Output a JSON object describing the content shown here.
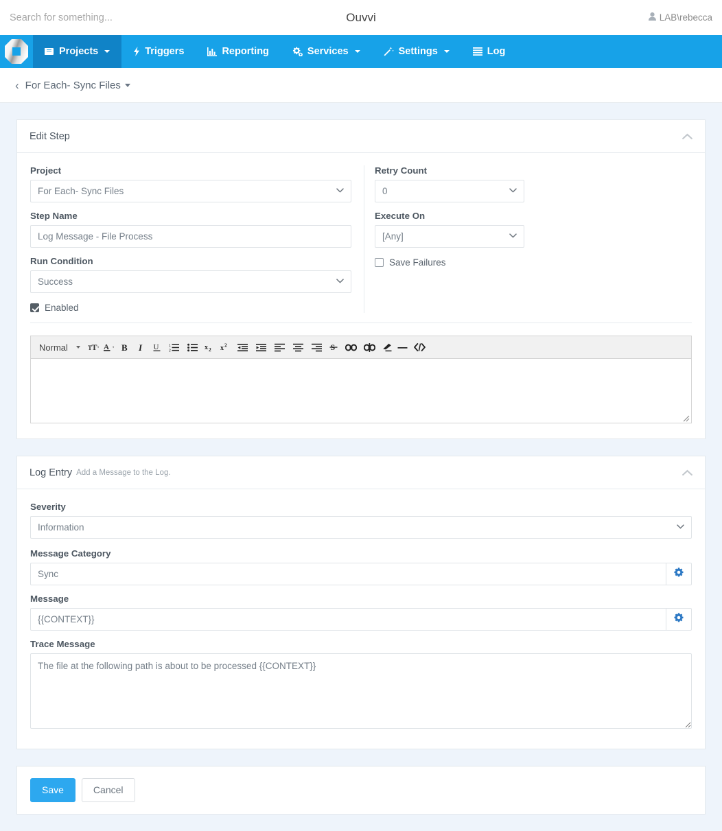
{
  "topbar": {
    "search_placeholder": "Search for something...",
    "search_value": "",
    "brand": "Ouvvi",
    "user": "LAB\\rebecca",
    "user_icon": "user-icon"
  },
  "nav": {
    "logo_icon": "ouvvi-logo-icon",
    "items": [
      {
        "label": "Projects",
        "icon": "book-icon",
        "caret": true,
        "active": true
      },
      {
        "label": "Triggers",
        "icon": "bolt-icon",
        "caret": false,
        "active": false
      },
      {
        "label": "Reporting",
        "icon": "bar-chart-icon",
        "caret": false,
        "active": false
      },
      {
        "label": "Services",
        "icon": "cogs-icon",
        "caret": true,
        "active": false
      },
      {
        "label": "Settings",
        "icon": "magic-wand-icon",
        "caret": true,
        "active": false
      },
      {
        "label": "Log",
        "icon": "align-justify-icon",
        "caret": false,
        "active": false
      }
    ]
  },
  "breadcrumb": {
    "back_icon": "chevron-left-icon",
    "title": "For Each- Sync Files",
    "caret_icon": "caret-down-icon"
  },
  "edit_step": {
    "title": "Edit Step",
    "collapse_icon": "chevron-up-icon",
    "project": {
      "label": "Project",
      "value": "For Each- Sync Files"
    },
    "step_name": {
      "label": "Step Name",
      "value": "Log Message - File Process",
      "placeholder": ""
    },
    "run_condition": {
      "label": "Run Condition",
      "value": "Success"
    },
    "enabled": {
      "label": "Enabled",
      "checked": true
    },
    "retry_count": {
      "label": "Retry Count",
      "value": "0"
    },
    "execute_on": {
      "label": "Execute On",
      "value": "[Any]"
    },
    "save_failures": {
      "label": "Save Failures",
      "checked": false
    },
    "editor": {
      "format_label": "Normal",
      "content": "",
      "tools": [
        {
          "name": "font-size-icon",
          "glyph": "TT"
        },
        {
          "name": "font-color-icon",
          "glyph": "A"
        },
        {
          "name": "bold-icon",
          "glyph": "B"
        },
        {
          "name": "italic-icon",
          "glyph": "I"
        },
        {
          "name": "underline-icon",
          "glyph": "U"
        },
        {
          "name": "ordered-list-icon",
          "glyph": ""
        },
        {
          "name": "bullet-list-icon",
          "glyph": ""
        },
        {
          "name": "subscript-icon",
          "glyph": "x₂"
        },
        {
          "name": "superscript-icon",
          "glyph": "x²"
        },
        {
          "name": "indent-decrease-icon",
          "glyph": ""
        },
        {
          "name": "indent-increase-icon",
          "glyph": ""
        },
        {
          "name": "align-left-icon",
          "glyph": ""
        },
        {
          "name": "align-center-icon",
          "glyph": ""
        },
        {
          "name": "align-right-icon",
          "glyph": ""
        },
        {
          "name": "strikethrough-icon",
          "glyph": "S"
        },
        {
          "name": "link-icon",
          "glyph": ""
        },
        {
          "name": "unlink-icon",
          "glyph": ""
        },
        {
          "name": "clean-format-icon",
          "glyph": ""
        },
        {
          "name": "horizontal-rule-icon",
          "glyph": "—"
        },
        {
          "name": "code-block-icon",
          "glyph": "<>"
        }
      ]
    }
  },
  "log_entry": {
    "title": "Log Entry",
    "subtitle": "Add a Message to the Log.",
    "collapse_icon": "chevron-up-icon",
    "severity": {
      "label": "Severity",
      "value": "Information"
    },
    "message_category": {
      "label": "Message Category",
      "value": "Sync",
      "button_icon": "gear-icon"
    },
    "message": {
      "label": "Message",
      "value": "{{CONTEXT}}",
      "button_icon": "gear-icon"
    },
    "trace_message": {
      "label": "Trace Message",
      "value": "The file at the following path is about to be processed {{CONTEXT}}"
    }
  },
  "footer_actions": {
    "save_label": "Save",
    "cancel_label": "Cancel"
  },
  "colors": {
    "nav_blue": "#17a2e8",
    "nav_active_blue": "#1083c7",
    "primary_button": "#2da8ef",
    "page_background": "#eef4fb",
    "gear_blue": "#2b78c4"
  }
}
